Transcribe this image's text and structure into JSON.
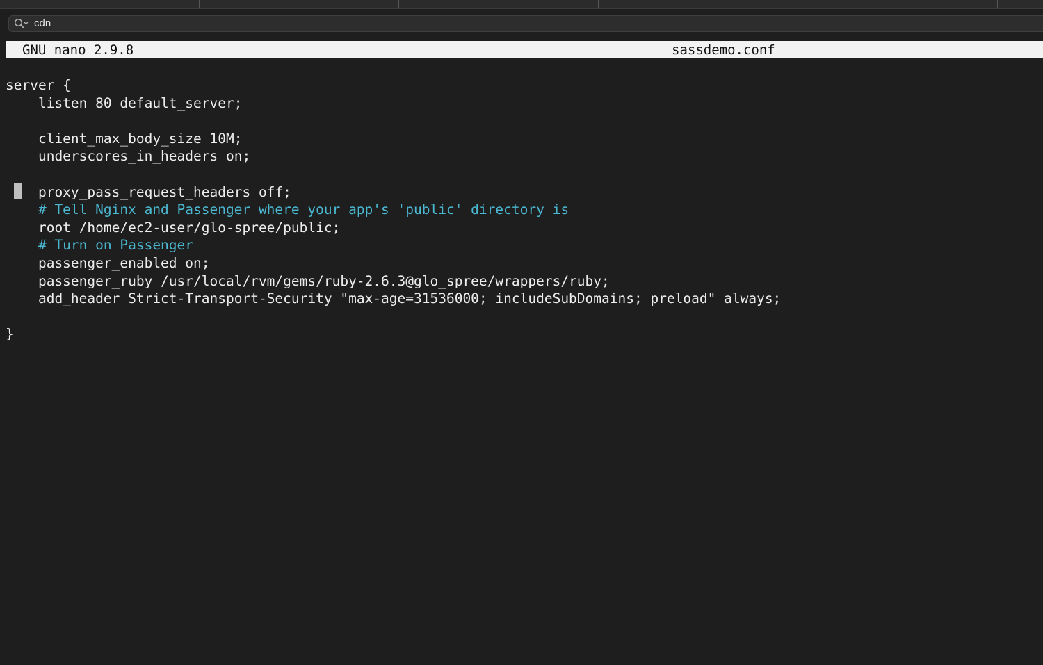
{
  "search": {
    "value": "cdn",
    "icon": "search-icon"
  },
  "nano": {
    "version": "GNU nano 2.9.8",
    "filename": "sassdemo.conf"
  },
  "editor": {
    "lines": [
      "server {",
      "    listen 80 default_server;",
      "",
      "    client_max_body_size 10M;",
      "    underscores_in_headers on;",
      "",
      "    proxy_pass_request_headers off;",
      "    # Tell Nginx and Passenger where your app's 'public' directory is",
      "    root /home/ec2-user/glo-spree/public;",
      "    # Turn on Passenger",
      "    passenger_enabled on;",
      "    passenger_ruby /usr/local/rvm/gems/ruby-2.6.3@glo_spree/wrappers/ruby;",
      "    add_header Strict-Transport-Security \"max-age=31536000; includeSubDomains; preload\" always;",
      "",
      "}"
    ],
    "comment_color": "#4bb8d1",
    "text_color": "#ededed"
  },
  "colors": {
    "background": "#1e1e1e",
    "header_background": "#f2f2f2"
  }
}
